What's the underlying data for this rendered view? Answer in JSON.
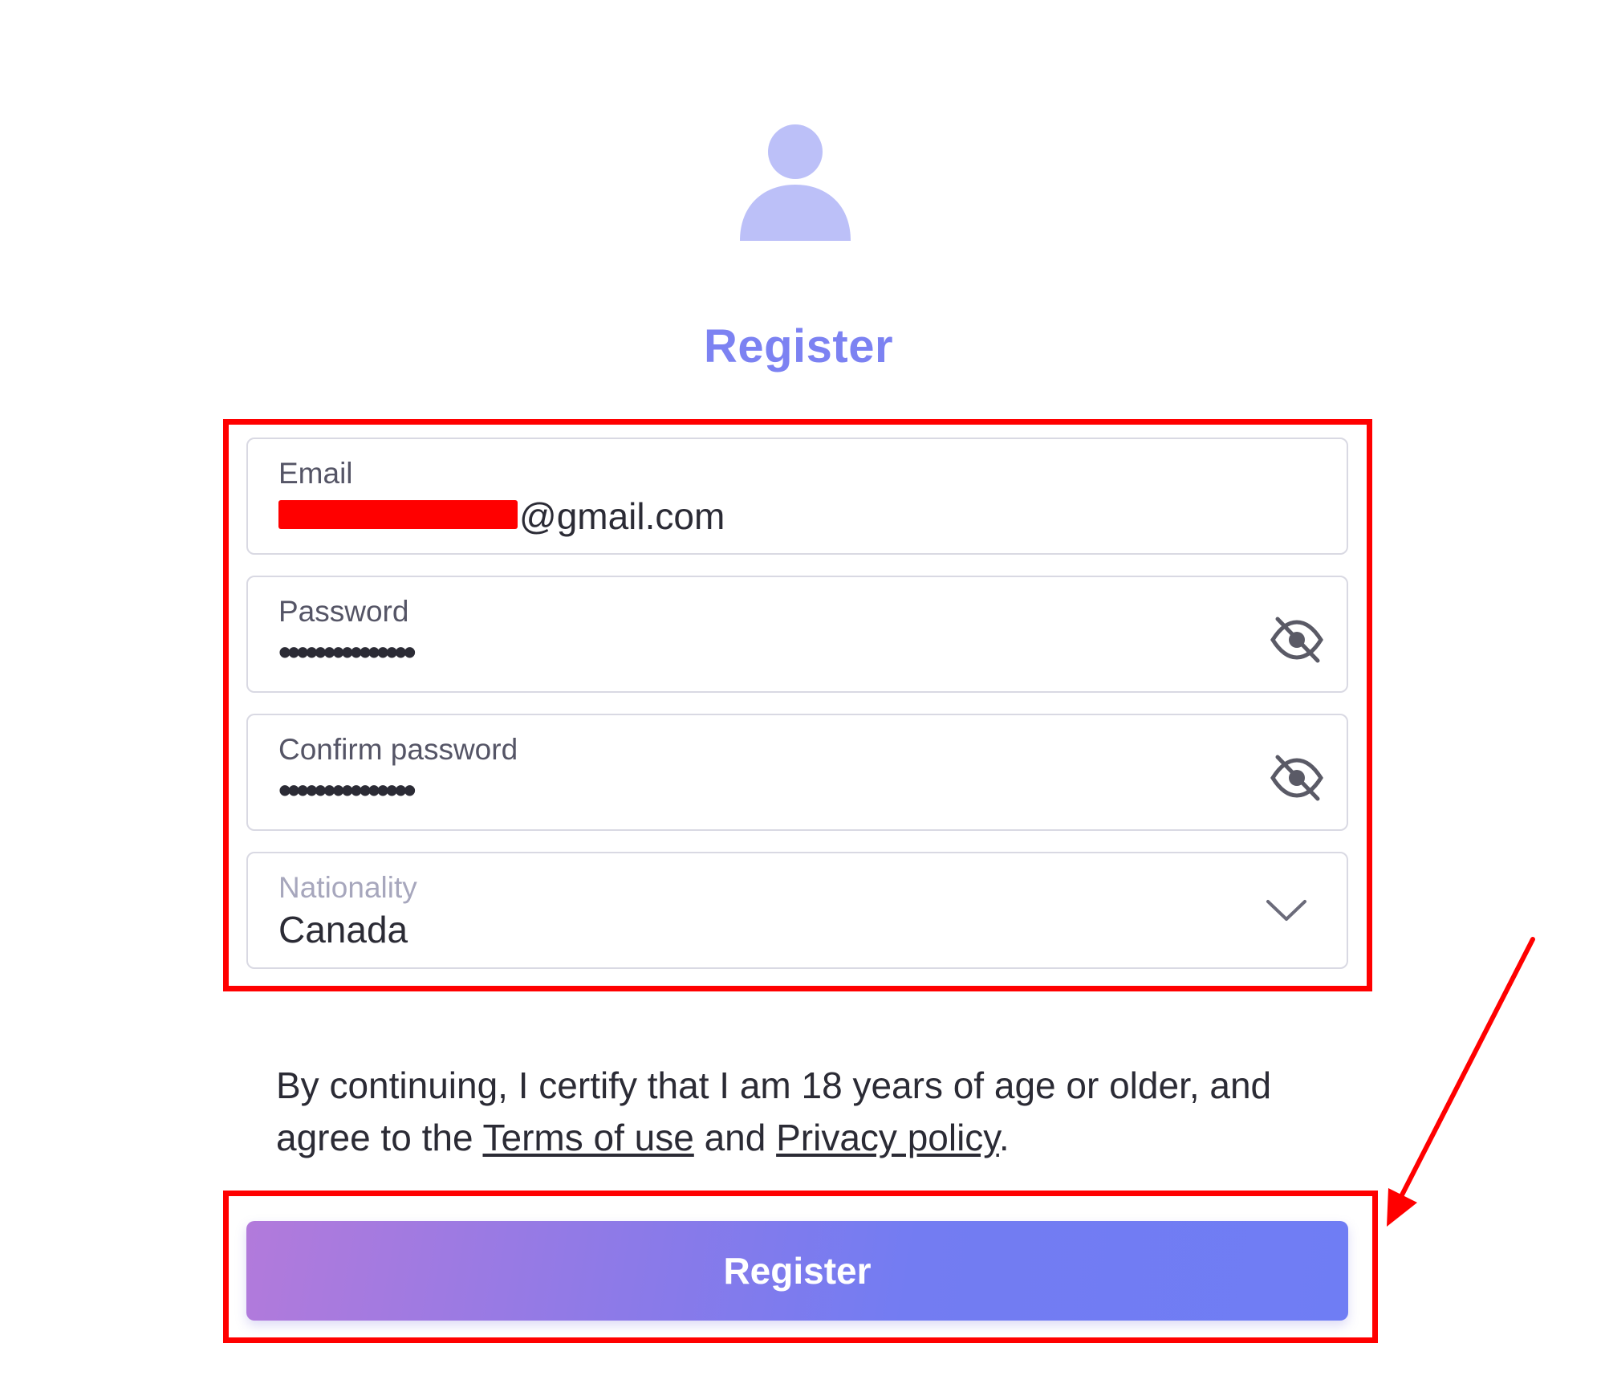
{
  "page": {
    "title": "Register"
  },
  "form": {
    "email": {
      "label": "Email",
      "value_visible_suffix": "@gmail.com"
    },
    "password": {
      "label": "Password",
      "masked_value": "•••••••••••••••"
    },
    "confirm_password": {
      "label": "Confirm password",
      "masked_value": "•••••••••••••••"
    },
    "nationality": {
      "label": "Nationality",
      "selected": "Canada"
    }
  },
  "consent": {
    "text_before": "By continuing, I certify that I am 18 years of age or older, and agree to the ",
    "terms_link": "Terms of use",
    "text_middle": " and ",
    "privacy_link": "Privacy policy",
    "text_after": "."
  },
  "submit": {
    "label": "Register"
  },
  "icons": {
    "avatar": "user-avatar-icon",
    "password_toggle": "eye-slash-icon",
    "confirm_toggle": "eye-slash-icon",
    "nationality_dropdown": "chevron-down-icon"
  },
  "colors": {
    "title": "#7c82f2",
    "avatar": "#bcc0f8",
    "annotation": "#ff0000",
    "button_gradient_start": "#b27adb",
    "button_gradient_end": "#6f7df4"
  }
}
